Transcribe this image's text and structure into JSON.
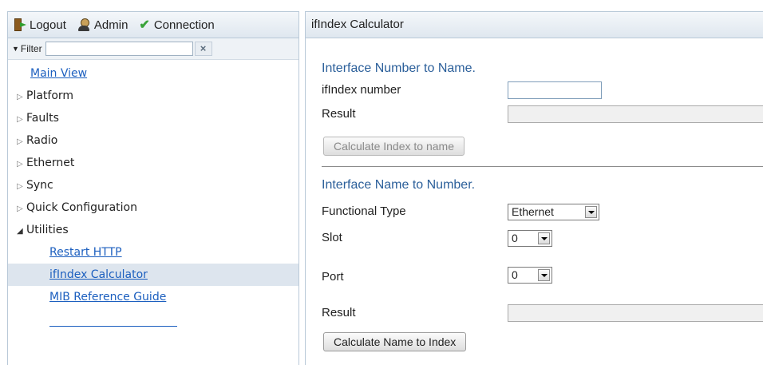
{
  "topbar": {
    "logout": "Logout",
    "admin": "Admin",
    "connection": "Connection"
  },
  "filter": {
    "label": "Filter",
    "value": "",
    "clear": "×"
  },
  "tree": {
    "main_view": "Main View",
    "platform": "Platform",
    "faults": "Faults",
    "radio": "Radio",
    "ethernet": "Ethernet",
    "sync": "Sync",
    "quick_config": "Quick Configuration",
    "utilities": "Utilities",
    "restart_http": "Restart HTTP",
    "ifindex_calc": "ifIndex Calculator",
    "mib_guide": "MIB Reference Guide"
  },
  "panel": {
    "title": "ifIndex Calculator",
    "section1": {
      "title": "Interface Number to Name.",
      "ifindex_label": "ifIndex number",
      "ifindex_value": "",
      "result_label": "Result",
      "result_value": "",
      "button": "Calculate Index to name"
    },
    "section2": {
      "title": "Interface Name to Number.",
      "type_label": "Functional Type",
      "type_value": "Ethernet",
      "slot_label": "Slot",
      "slot_value": "0",
      "port_label": "Port",
      "port_value": "0",
      "result_label": "Result",
      "result_value": "",
      "button": "Calculate Name to Index"
    }
  }
}
